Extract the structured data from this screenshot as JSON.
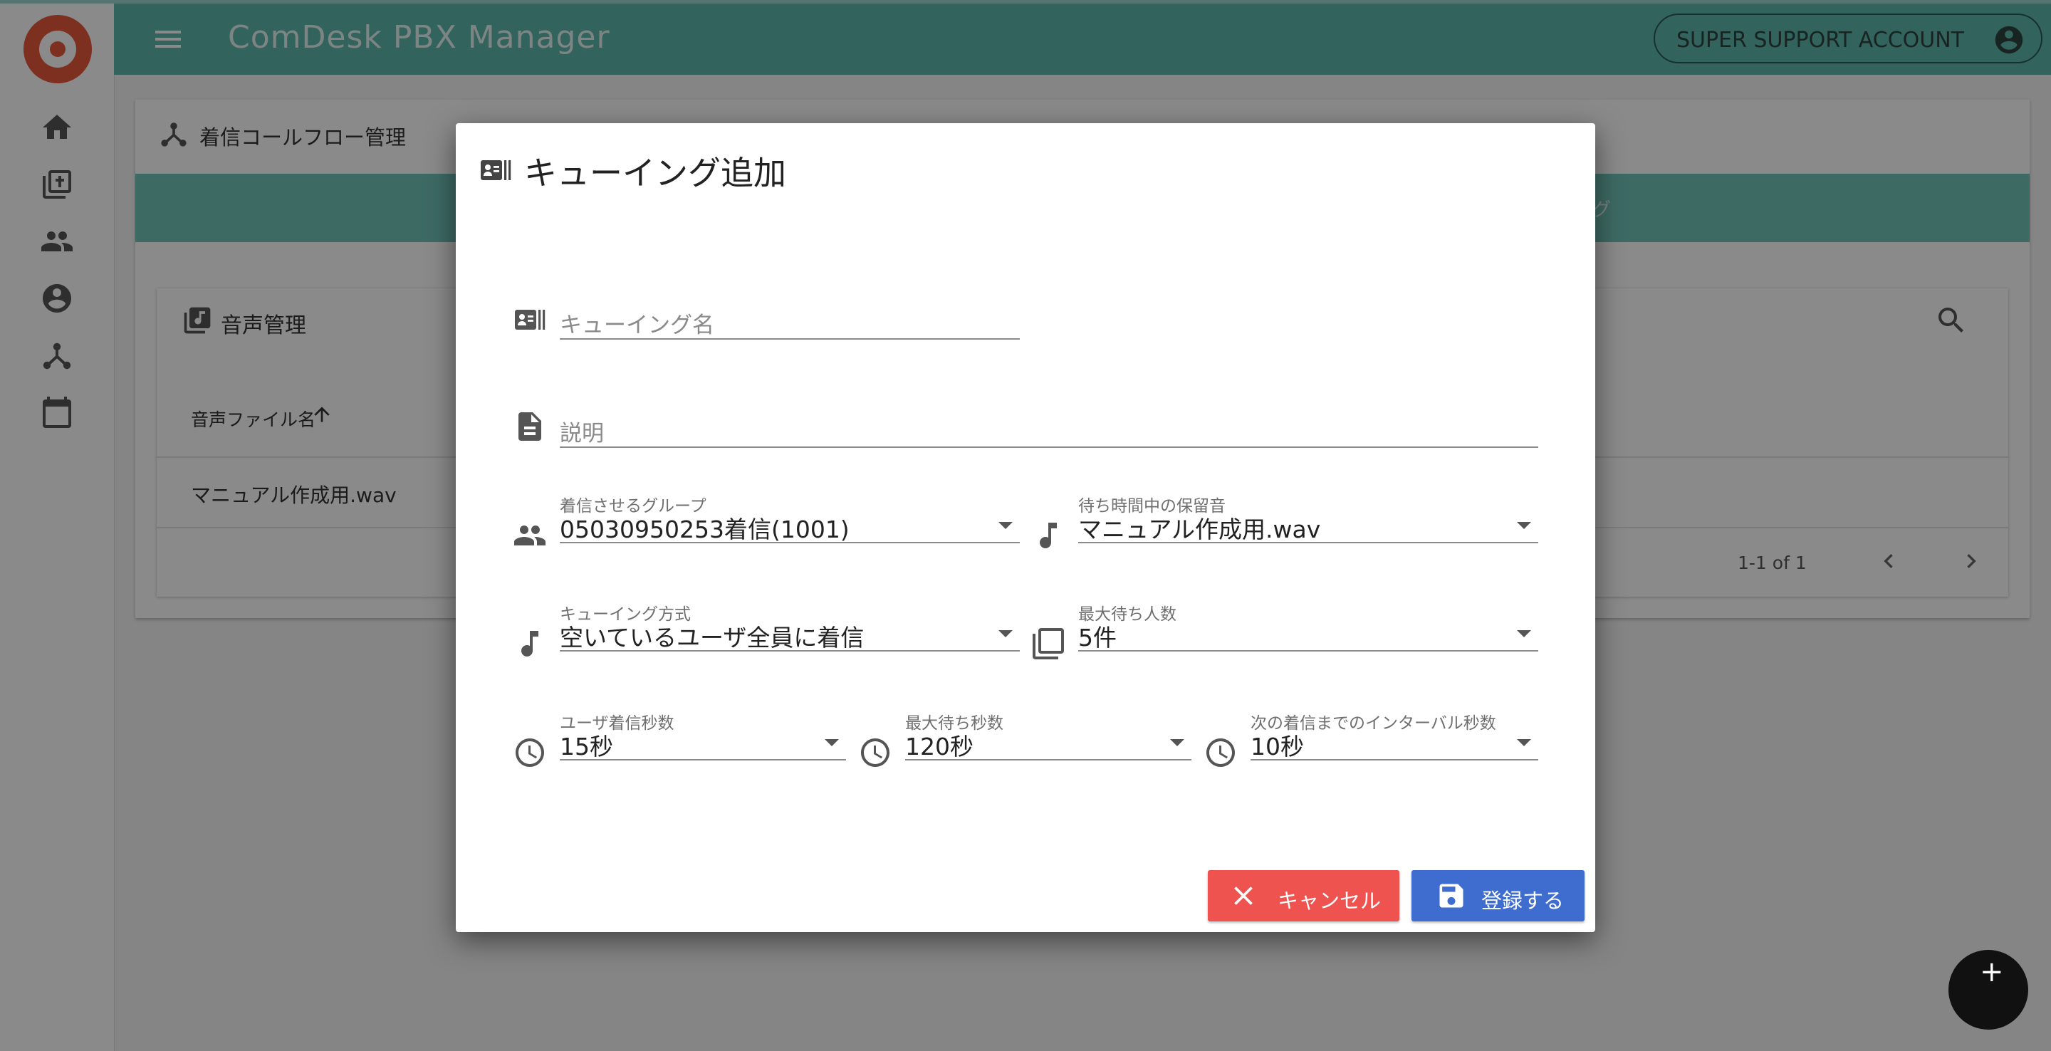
{
  "app": {
    "title": "ComDesk PBX Manager",
    "account_label": "SUPER SUPPORT ACCOUNT"
  },
  "page": {
    "header_title": "着信コールフロー管理",
    "tab_right_fragment": "グ",
    "audio_section": {
      "title": "音声管理",
      "column_header": "音声ファイル名",
      "rows": [
        "マニュアル作成用.wav"
      ],
      "pagination": "1-1 of 1"
    }
  },
  "dialog": {
    "title": "キューイング追加",
    "fields": {
      "queue_name": {
        "placeholder": "キューイング名"
      },
      "description": {
        "placeholder": "説明"
      },
      "group": {
        "label": "着信させるグループ",
        "value": "05030950253着信(1001)"
      },
      "hold_sound": {
        "label": "待ち時間中の保留音",
        "value": "マニュアル作成用.wav"
      },
      "queue_method": {
        "label": "キューイング方式",
        "value": "空いているユーザ全員に着信"
      },
      "max_waiters": {
        "label": "最大待ち人数",
        "value": "5件"
      },
      "user_ring_seconds": {
        "label": "ユーザ着信秒数",
        "value": "15秒"
      },
      "max_wait_seconds": {
        "label": "最大待ち秒数",
        "value": "120秒"
      },
      "interval_seconds": {
        "label": "次の着信までのインターバル秒数",
        "value": "10秒"
      }
    },
    "buttons": {
      "cancel": "キャンセル",
      "save": "登録する"
    }
  },
  "fab": {
    "label": "+"
  },
  "colors": {
    "appbar": "#5fb8ad",
    "cancel": "#ef5350",
    "save": "#3e6ccf",
    "logo": "#e85a3a"
  }
}
